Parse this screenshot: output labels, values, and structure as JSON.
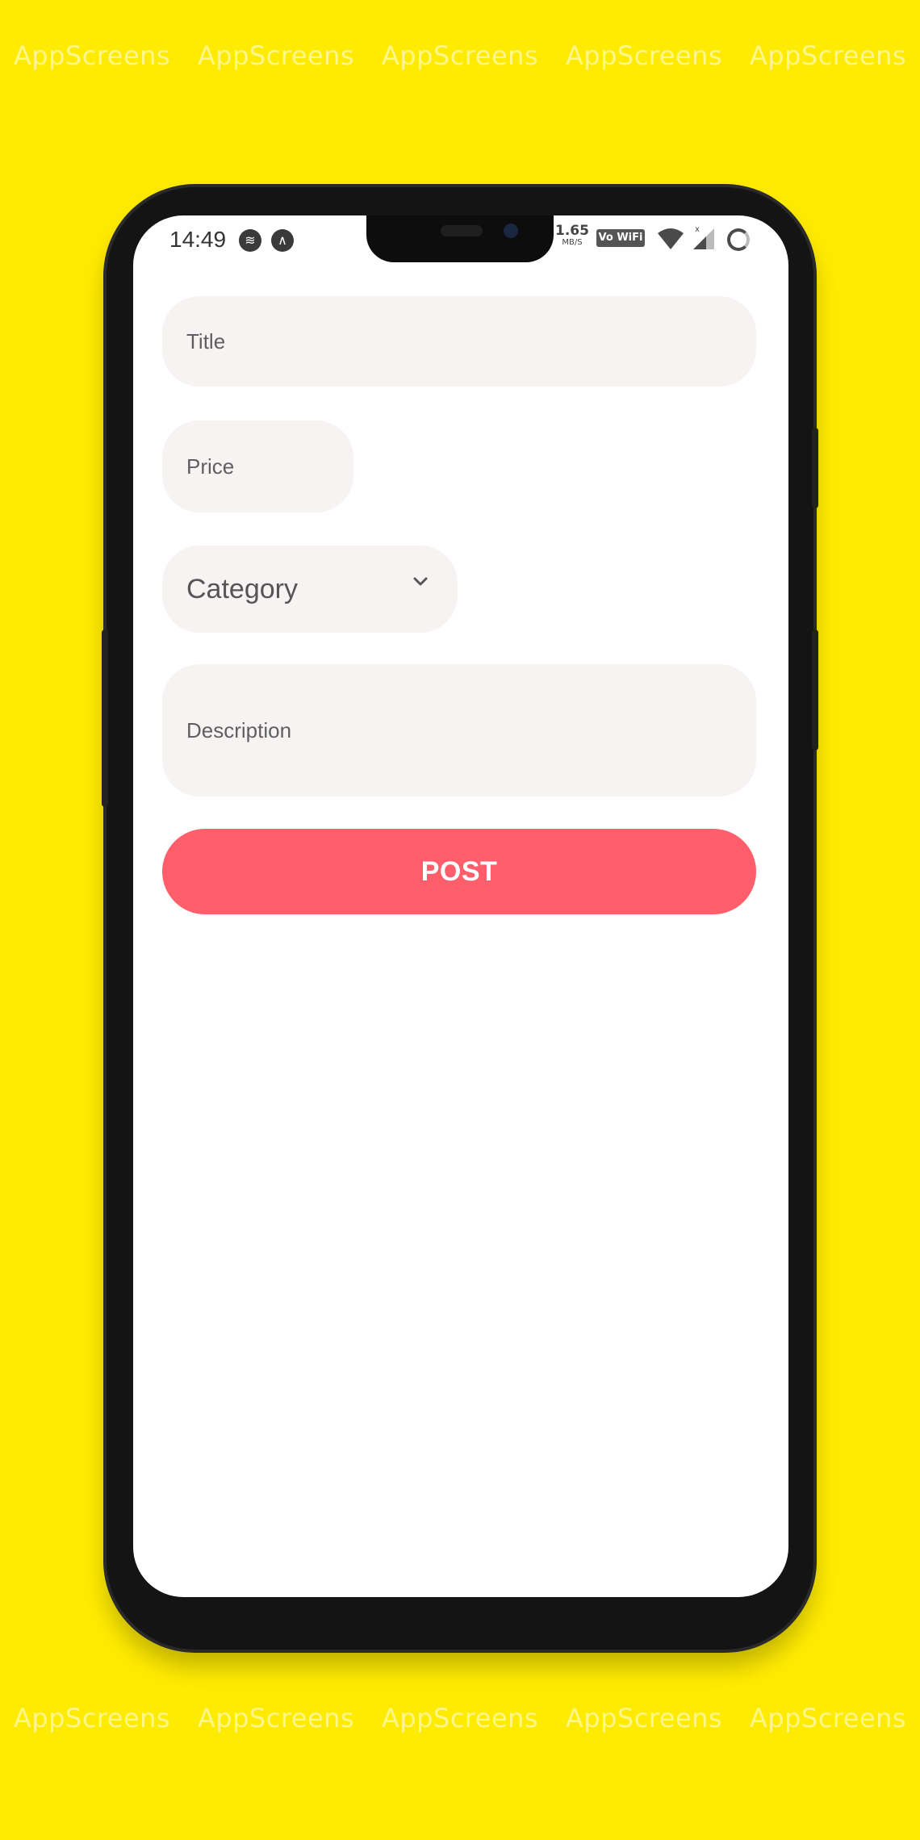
{
  "watermark": "AppScreens",
  "status_bar": {
    "time": "14:49",
    "icons": [
      "spotify-icon",
      "arc-icon",
      "wifi-icon",
      "signal-icon",
      "ring-icon"
    ],
    "speed_value": "1.65",
    "speed_unit": "MB/S",
    "vowifi": "Vo WiFi"
  },
  "form": {
    "title_placeholder": "Title",
    "price_placeholder": "Price",
    "category_label": "Category",
    "description_placeholder": "Description"
  },
  "post_button": "POST",
  "colors": {
    "background": "#FFEB00",
    "field": "#F7F3F3",
    "accent": "#FF5E6A"
  }
}
